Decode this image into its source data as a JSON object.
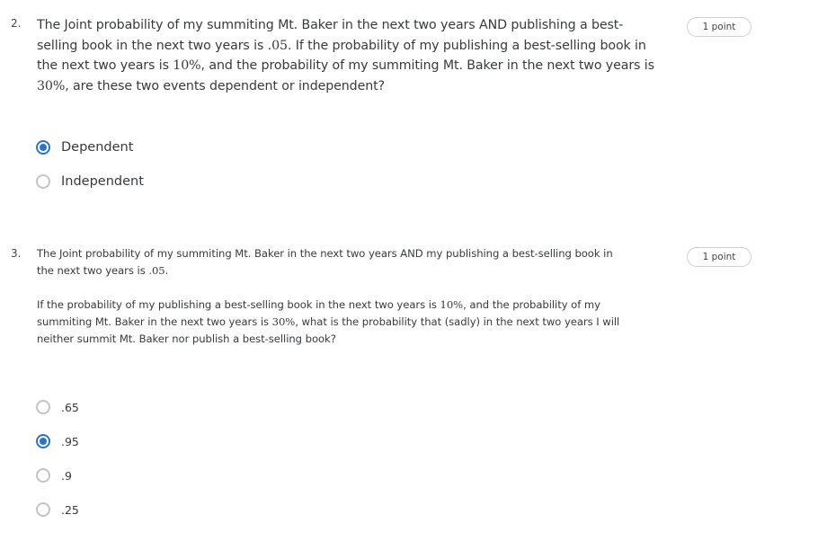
{
  "questions": [
    {
      "number": "2.",
      "points": "1 point",
      "lines": [
        [
          {
            "t": "The Joint probability of my summiting Mt. Baker in the next two years AND publishing a best-"
          }
        ],
        [
          {
            "t": "selling book in the next two years is "
          },
          {
            "t": ".05",
            "math": true
          },
          {
            "t": ". If the probability of my publishing a best-selling book in"
          }
        ],
        [
          {
            "t": "the next two years is "
          },
          {
            "t": "10%",
            "math": true
          },
          {
            "t": ", and the probability of my summiting Mt. Baker in the next two years is"
          }
        ],
        [
          {
            "t": "30%",
            "math": true
          },
          {
            "t": ", are these two events dependent or independent?"
          }
        ]
      ],
      "options": [
        {
          "label": "Dependent",
          "selected": true
        },
        {
          "label": "Independent",
          "selected": false
        }
      ]
    },
    {
      "number": "3.",
      "points": "1 point",
      "lines": [
        [
          {
            "t": "The Joint probability of my summiting Mt. Baker in the next two years AND my publishing a best-selling book in"
          }
        ],
        [
          {
            "t": "the next two years is "
          },
          {
            "t": ".05",
            "math": true
          },
          {
            "t": "."
          }
        ],
        [],
        [
          {
            "t": "If the probability of my publishing a best-selling book in the next two years is "
          },
          {
            "t": "10%",
            "math": true
          },
          {
            "t": ", and the probability of my"
          }
        ],
        [
          {
            "t": "summiting Mt. Baker in the next two years is "
          },
          {
            "t": "30%",
            "math": true
          },
          {
            "t": ", what is the probability that (sadly) in the next two years I will"
          }
        ],
        [
          {
            "t": "neither summit Mt. Baker nor publish a best-selling book?"
          }
        ]
      ],
      "options": [
        {
          "label": ".65",
          "selected": false
        },
        {
          "label": ".95",
          "selected": true
        },
        {
          "label": ".9",
          "selected": false
        },
        {
          "label": ".25",
          "selected": false
        }
      ]
    }
  ],
  "colors": {
    "accent": "#2a73cc",
    "radio_border": "#c4c4c4"
  }
}
